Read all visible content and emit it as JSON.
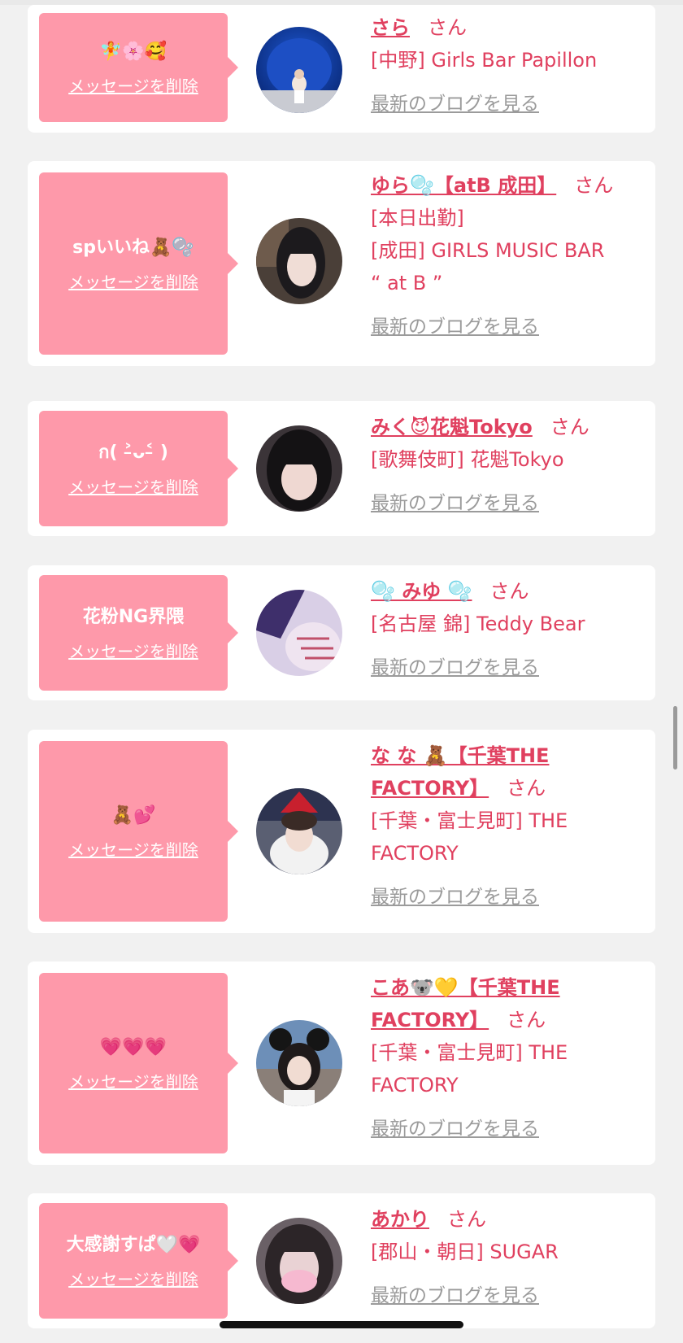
{
  "delete_label": "メッセージを削除",
  "blog_label": "最新のブログを見る",
  "san_label": "さん",
  "colors": {
    "bubble": "#fe99aa",
    "accent": "#e0405f",
    "muted": "#9b9b9b",
    "background": "#f1f1f1"
  },
  "entries": [
    {
      "message": "🧚🌸🥰",
      "name": "さら",
      "shop_lines": [
        "[中野] Girls Bar Papillon"
      ],
      "avatar": "avatar-blue-chair"
    },
    {
      "message": "spいいね🧸🫧",
      "name": "ゆら🫧【atB 成田】",
      "shop_lines": [
        "[本日出勤]",
        "[成田] GIRLS MUSIC BAR",
        "“ at B ”"
      ],
      "avatar": "avatar-dark-hair"
    },
    {
      "message": "ก(  ˃̵ᴗ˂̵ )",
      "name": "みく😈花魁Tokyo",
      "shop_lines": [
        "[歌舞伎町] 花魁Tokyo"
      ],
      "avatar": "avatar-bangs"
    },
    {
      "message": "花粉NG界隈",
      "name": "🫧 みゆ 🫧",
      "shop_lines": [
        "[名古屋 錦] Teddy Bear"
      ],
      "avatar": "avatar-purple-blur"
    },
    {
      "message": "🧸💕",
      "name": "な な 🧸【千葉THE FACTORY】",
      "shop_lines": [
        "[千葉・富士見町] THE",
        "FACTORY"
      ],
      "avatar": "avatar-santa-hat"
    },
    {
      "message": "💗💗💗",
      "name": "こあ🐨💛【千葉THE FACTORY】",
      "shop_lines": [
        "[千葉・富士見町] THE",
        "FACTORY"
      ],
      "avatar": "avatar-mouse-ears"
    },
    {
      "message": "大感謝すぱ🤍💗",
      "name": "あかり",
      "shop_lines": [
        "[郡山・朝日] SUGAR"
      ],
      "avatar": "avatar-pink-blur"
    }
  ]
}
